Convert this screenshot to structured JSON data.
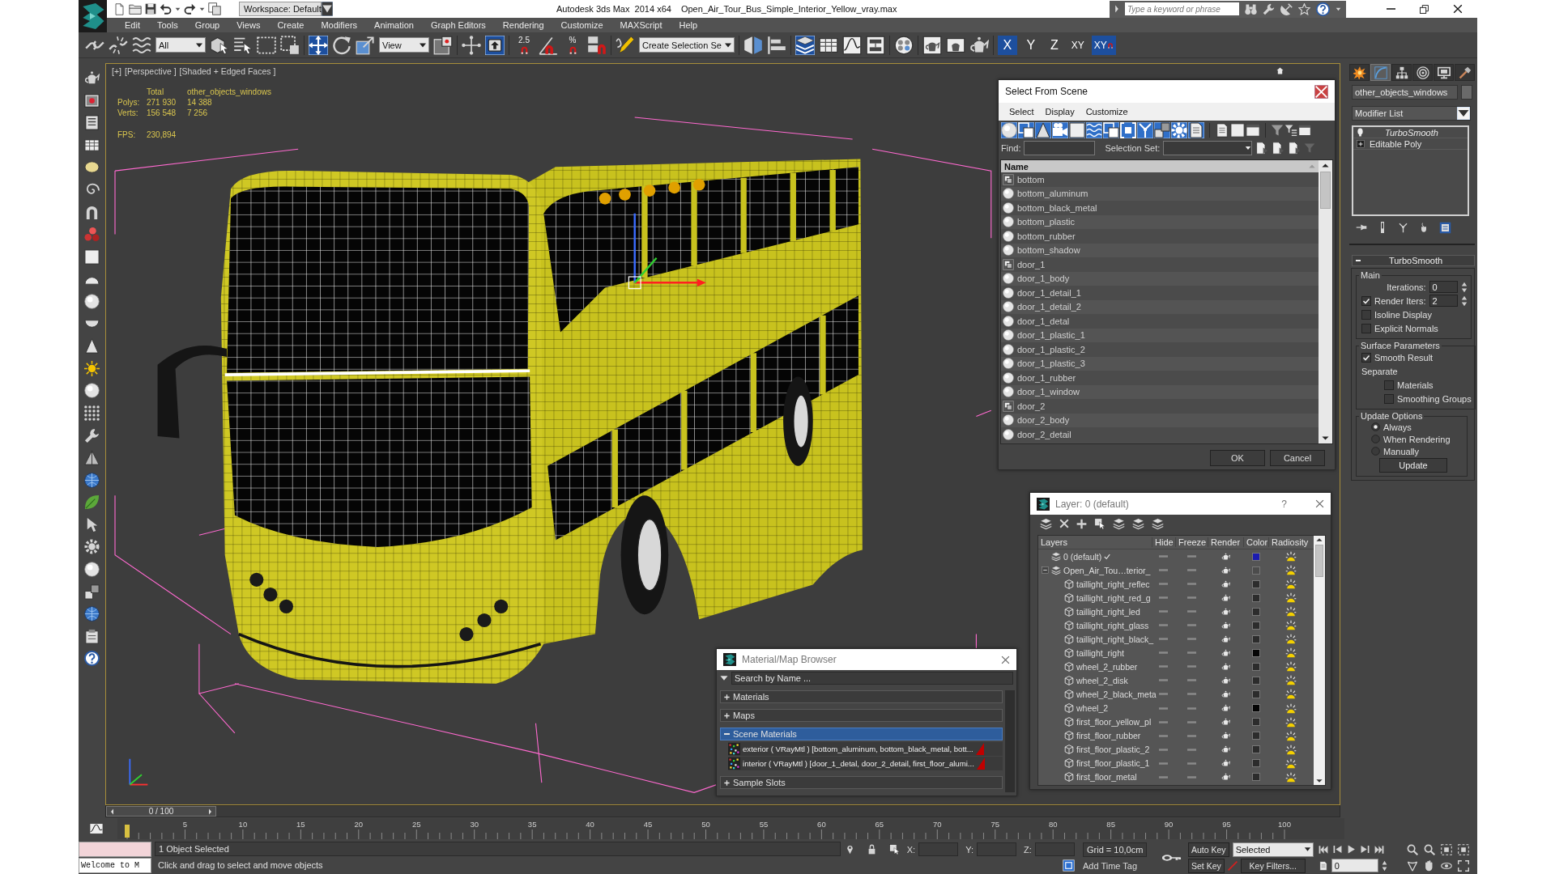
{
  "title_bar": {
    "workspace": "Workspace: Default",
    "app_title": "Autodesk 3ds Max  2014 x64",
    "file_name": "Open_Air_Tour_Bus_Simple_Interior_Yellow_vray.max",
    "search": {
      "placeholder": "Type a keyword or phrase"
    }
  },
  "menu_bar": [
    "Edit",
    "Tools",
    "Group",
    "Views",
    "Create",
    "Modifiers",
    "Animation",
    "Graph Editors",
    "Rendering",
    "Customize",
    "MAXScript",
    "Help"
  ],
  "main_toolbar": {
    "groups": [
      {
        "items": [
          {
            "kind": "tool",
            "selected": false
          },
          {
            "kind": "tool",
            "selected": false
          },
          {
            "kind": "tool",
            "selected": false
          },
          {
            "kind": "dropdown",
            "value": "All"
          },
          {
            "kind": "tool",
            "selected": false
          },
          {
            "kind": "tool",
            "selected": false
          },
          {
            "kind": "tool",
            "selected": false
          },
          {
            "kind": "tool",
            "selected": false
          }
        ]
      },
      {
        "items": [
          {
            "kind": "tool",
            "selected": true
          },
          {
            "kind": "tool",
            "selected": false
          },
          {
            "kind": "tool",
            "selected": false
          },
          {
            "kind": "dropdown",
            "value": "View"
          },
          {
            "kind": "tool",
            "selected": false
          }
        ]
      },
      {
        "items": [
          {
            "kind": "tool",
            "selected": false
          },
          {
            "kind": "tool",
            "selected": true
          }
        ]
      },
      {
        "items": [
          {
            "kind": "snap",
            "label": "2.5",
            "selected": false
          },
          {
            "kind": "tool",
            "selected": false
          },
          {
            "kind": "snap",
            "label": "%",
            "selected": false
          },
          {
            "kind": "tool",
            "selected": false
          }
        ]
      },
      {
        "items": [
          {
            "kind": "tool",
            "selected": false
          },
          {
            "kind": "dropdown",
            "value": "Create Selection Se"
          }
        ]
      },
      {
        "items": [
          {
            "kind": "tool",
            "selected": false
          },
          {
            "kind": "tool",
            "selected": false
          }
        ]
      },
      {
        "items": [
          {
            "kind": "tool",
            "selected": true
          },
          {
            "kind": "tool",
            "selected": false
          },
          {
            "kind": "tool",
            "selected": false
          },
          {
            "kind": "tool",
            "selected": false
          }
        ]
      },
      {
        "items": [
          {
            "kind": "tool",
            "selected": false
          }
        ]
      },
      {
        "items": [
          {
            "kind": "tool",
            "selected": false
          },
          {
            "kind": "tool",
            "selected": false
          },
          {
            "kind": "tool",
            "selected": false
          }
        ]
      },
      {
        "items": [
          {
            "kind": "axis",
            "label": "X",
            "selected": true
          },
          {
            "kind": "axis",
            "label": "Y",
            "selected": false
          },
          {
            "kind": "axis",
            "label": "Z",
            "selected": false
          },
          {
            "kind": "plane",
            "label": "XY",
            "selected": false
          },
          {
            "kind": "snap_plane",
            "label": "XY",
            "selected": true
          }
        ]
      }
    ]
  },
  "viewport": {
    "labels": [
      "[+]",
      "[Perspective ]",
      "[Shaded + Edged Faces ]"
    ],
    "stats": {
      "headers": [
        "Total",
        "other_objects_windows"
      ],
      "rows": [
        {
          "label": "Polys:",
          "values": [
            "271 930",
            "14 388"
          ]
        },
        {
          "label": "Verts:",
          "values": [
            "156 548",
            "7 256"
          ]
        }
      ],
      "fps": {
        "label": "FPS:",
        "value": "230,894"
      }
    }
  },
  "select_from_scene": {
    "title": "Select From Scene",
    "menu": [
      "Select",
      "Display",
      "Customize"
    ],
    "filters": [
      {
        "selected": true
      },
      {
        "selected": true
      },
      {
        "selected": true
      },
      {
        "selected": true
      },
      {
        "selected": true
      },
      {
        "selected": true
      },
      {
        "selected": true
      },
      {
        "selected": true
      },
      {
        "selected": true
      },
      {
        "selected": true
      },
      {
        "selected": true
      },
      {
        "selected": true
      }
    ],
    "find_label": "Find:",
    "selection_set_label": "Selection Set:",
    "column": "Name",
    "rows": [
      {
        "name": "bottom",
        "kind": "group",
        "selected": false
      },
      {
        "name": "bottom_aluminum",
        "kind": "object",
        "selected": false
      },
      {
        "name": "bottom_black_metal",
        "kind": "object",
        "selected": false
      },
      {
        "name": "bottom_plastic",
        "kind": "object",
        "selected": false
      },
      {
        "name": "bottom_rubber",
        "kind": "object",
        "selected": false
      },
      {
        "name": "bottom_shadow",
        "kind": "object",
        "selected": false
      },
      {
        "name": "door_1",
        "kind": "group",
        "selected": false
      },
      {
        "name": "door_1_body",
        "kind": "object",
        "selected": false
      },
      {
        "name": "door_1_detail_1",
        "kind": "object",
        "selected": false
      },
      {
        "name": "door_1_detail_2",
        "kind": "object",
        "selected": false
      },
      {
        "name": "door_1_detal",
        "kind": "object",
        "selected": false
      },
      {
        "name": "door_1_plastic_1",
        "kind": "object",
        "selected": false
      },
      {
        "name": "door_1_plastic_2",
        "kind": "object",
        "selected": false
      },
      {
        "name": "door_1_plastic_3",
        "kind": "object",
        "selected": false
      },
      {
        "name": "door_1_rubber",
        "kind": "object",
        "selected": false
      },
      {
        "name": "door_1_window",
        "kind": "object",
        "selected": false
      },
      {
        "name": "door_2",
        "kind": "group",
        "selected": false
      },
      {
        "name": "door_2_body",
        "kind": "object",
        "selected": false
      },
      {
        "name": "door_2_detail",
        "kind": "object",
        "selected": false
      }
    ],
    "buttons": [
      "OK",
      "Cancel"
    ]
  },
  "layer_dialog": {
    "title": "Layer: 0 (default)",
    "help": "?",
    "columns": [
      "Layers",
      "Hide",
      "Freeze",
      "Render",
      "Color",
      "Radiosity"
    ],
    "rows": [
      {
        "name": "0 (default)",
        "kind": "layer",
        "current": true,
        "hide": false,
        "freeze": false,
        "color": "#1c1cb0"
      },
      {
        "name": "Open_Air_Tou…terior_",
        "kind": "layer",
        "current": false,
        "expanded": true,
        "hide": false,
        "freeze": false,
        "color": "#4c4c4c",
        "children": [
          {
            "name": "taillight_right_reflec",
            "kind": "object",
            "hide": false,
            "freeze": false,
            "color": "#2c2c2c"
          },
          {
            "name": "taillight_right_red_g",
            "kind": "object",
            "hide": false,
            "freeze": false,
            "color": "#2c2c2c"
          },
          {
            "name": "taillight_right_led",
            "kind": "object",
            "hide": false,
            "freeze": false,
            "color": "#2c2c2c"
          },
          {
            "name": "taillight_right_glass",
            "kind": "object",
            "hide": false,
            "freeze": false,
            "color": "#2c2c2c"
          },
          {
            "name": "taillight_right_black_",
            "kind": "object",
            "hide": false,
            "freeze": false,
            "color": "#2c2c2c"
          },
          {
            "name": "taillight_right",
            "kind": "object",
            "hide": false,
            "freeze": false,
            "color": "#050505"
          },
          {
            "name": "wheel_2_rubber",
            "kind": "object",
            "hide": false,
            "freeze": false,
            "color": "#2c2c2c"
          },
          {
            "name": "wheel_2_disk",
            "kind": "object",
            "hide": false,
            "freeze": false,
            "color": "#2c2c2c"
          },
          {
            "name": "wheel_2_black_meta",
            "kind": "object",
            "hide": false,
            "freeze": false,
            "color": "#2c2c2c"
          },
          {
            "name": "wheel_2",
            "kind": "object",
            "hide": false,
            "freeze": false,
            "color": "#050505"
          },
          {
            "name": "first_floor_yellow_pl",
            "kind": "object",
            "hide": false,
            "freeze": false,
            "color": "#2c2c2c"
          },
          {
            "name": "first_floor_rubber",
            "kind": "object",
            "hide": false,
            "freeze": false,
            "color": "#2c2c2c"
          },
          {
            "name": "first_floor_plastic_2",
            "kind": "object",
            "hide": false,
            "freeze": false,
            "color": "#2c2c2c"
          },
          {
            "name": "first_floor_plastic_1",
            "kind": "object",
            "hide": false,
            "freeze": false,
            "color": "#2c2c2c"
          },
          {
            "name": "first_floor_metal",
            "kind": "object",
            "hide": false,
            "freeze": false,
            "color": "#2c2c2c"
          }
        ]
      }
    ]
  },
  "material_browser": {
    "title": "Material/Map Browser",
    "search": {
      "placeholder": "Search by Name ..."
    },
    "groups": [
      {
        "title": "Materials",
        "expanded": false,
        "selected": false
      },
      {
        "title": "Maps",
        "expanded": false,
        "selected": false
      },
      {
        "title": "Scene Materials",
        "expanded": true,
        "selected": true,
        "items": [
          {
            "name": "exterior ( VRayMtl ) [bottom_aluminum, bottom_black_metal, bott..."
          },
          {
            "name": "interior ( VRayMtl ) [door_1_detal, door_2_detail, first_floor_alumi..."
          }
        ]
      },
      {
        "title": "Sample Slots",
        "expanded": false,
        "selected": false
      }
    ]
  },
  "command_panel": {
    "tabs": [
      {
        "selected": false
      },
      {
        "selected": true
      },
      {
        "selected": false
      },
      {
        "selected": false
      },
      {
        "selected": false
      },
      {
        "selected": false
      }
    ],
    "object_name": "other_objects_windows",
    "modifier_list": "Modifier List",
    "stack": [
      {
        "kind": "modifier",
        "name": "TurboSmooth"
      },
      {
        "kind": "base_object",
        "name": "Editable Poly"
      }
    ],
    "rollout": {
      "title": "TurboSmooth",
      "expanded": true,
      "groups": [
        {
          "title": "Main",
          "controls": [
            {
              "kind": "spinner",
              "label": "Iterations:",
              "value": "0"
            },
            {
              "kind": "check_spinner",
              "label": "Render Iters:",
              "checked": true,
              "value": "2"
            },
            {
              "kind": "checkbox",
              "label": "Isoline Display",
              "checked": false
            },
            {
              "kind": "checkbox",
              "label": "Explicit Normals",
              "checked": false
            }
          ]
        },
        {
          "title": "Surface Parameters",
          "controls": [
            {
              "kind": "checkbox",
              "label": "Smooth Result",
              "checked": true
            },
            {
              "kind": "label",
              "label": "Separate",
              "children": [
                {
                  "kind": "checkbox",
                  "label": "Materials",
                  "checked": false
                },
                {
                  "kind": "checkbox",
                  "label": "Smoothing Groups",
                  "checked": false
                }
              ]
            }
          ]
        },
        {
          "title": "Update Options",
          "controls": [
            {
              "kind": "radio",
              "label": "Always",
              "selected": true
            },
            {
              "kind": "radio",
              "label": "When Rendering",
              "selected": false
            },
            {
              "kind": "radio",
              "label": "Manually",
              "selected": false
            },
            {
              "kind": "button",
              "label": "Update"
            }
          ]
        }
      ]
    }
  },
  "time_slider": {
    "label": "0 / 100",
    "level": 0
  },
  "track_bar": {
    "ticks": [
      "5",
      "10",
      "15",
      "20",
      "25",
      "30",
      "35",
      "40",
      "45",
      "50",
      "55",
      "60",
      "65",
      "70",
      "75",
      "80",
      "85",
      "90",
      "95",
      "100"
    ]
  },
  "status_bar": {
    "listener": "Welcome to M",
    "selection": "1 Object Selected",
    "prompt": "Click and drag to select and move objects",
    "coords": [
      {
        "label": "X:"
      },
      {
        "label": "Y:"
      },
      {
        "label": "Z:"
      }
    ],
    "grid": "Grid = 10,0cm",
    "add_time_tag": "Add Time Tag"
  },
  "animation_controls": {
    "auto_key": "Auto Key",
    "key_mode": "Selected",
    "set_key": "Set Key",
    "key_filters": "Key Filters...",
    "frame": "0"
  }
}
